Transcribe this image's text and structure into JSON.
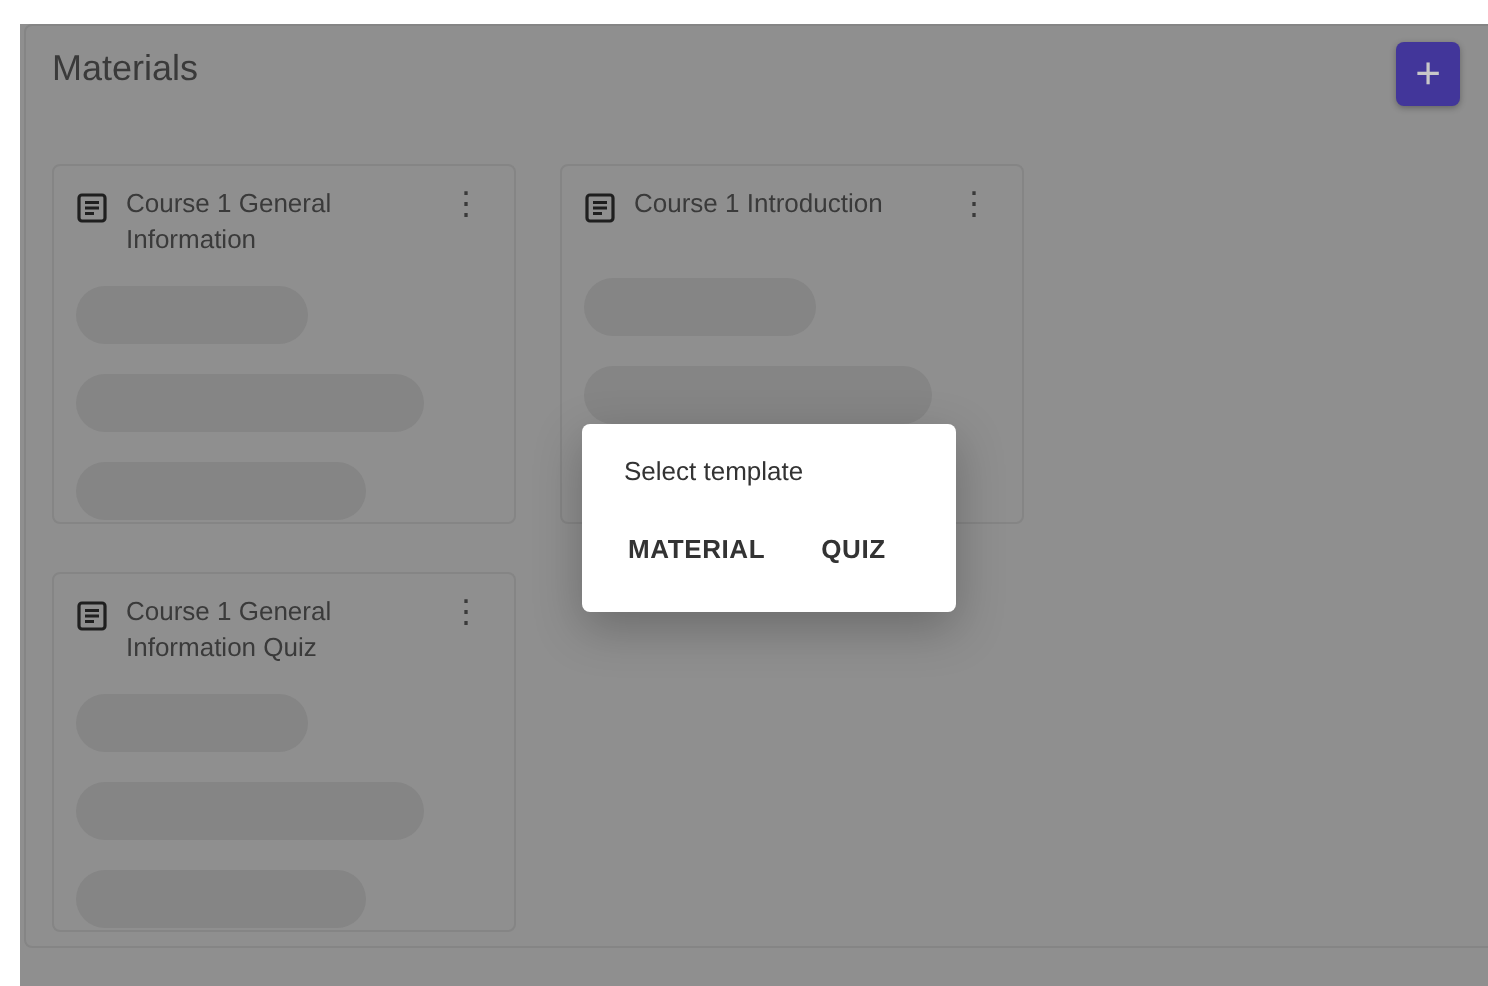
{
  "panel": {
    "title": "Materials",
    "add_button": "+"
  },
  "cards": [
    {
      "title": "Course 1 General Information",
      "menu": "⋮"
    },
    {
      "title": "Course 1 Introduction",
      "menu": "⋮"
    },
    {
      "title": "Course 1 General Information Quiz",
      "menu": "⋮"
    }
  ],
  "dialog": {
    "title": "Select template",
    "buttons": [
      "MATERIAL",
      "QUIZ"
    ]
  }
}
